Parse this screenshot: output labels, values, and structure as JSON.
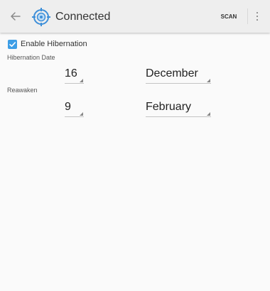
{
  "action_bar": {
    "back_icon": "arrow-left-icon",
    "logo_icon": "crosshair-target-icon",
    "title": "Connected",
    "scan_label": "SCAN",
    "overflow_icon": "more-vertical-icon"
  },
  "hibernation": {
    "enable_checked": true,
    "enable_label": "Enable Hibernation",
    "date_label": "Hibernation Date",
    "date_day": "16",
    "date_month": "December",
    "reawaken_label": "Reawaken",
    "reawaken_day": "9",
    "reawaken_month": "February"
  },
  "colors": {
    "accent": "#3d9ee6",
    "action_bar_bg": "#eeeeee",
    "background": "#fafafa"
  }
}
